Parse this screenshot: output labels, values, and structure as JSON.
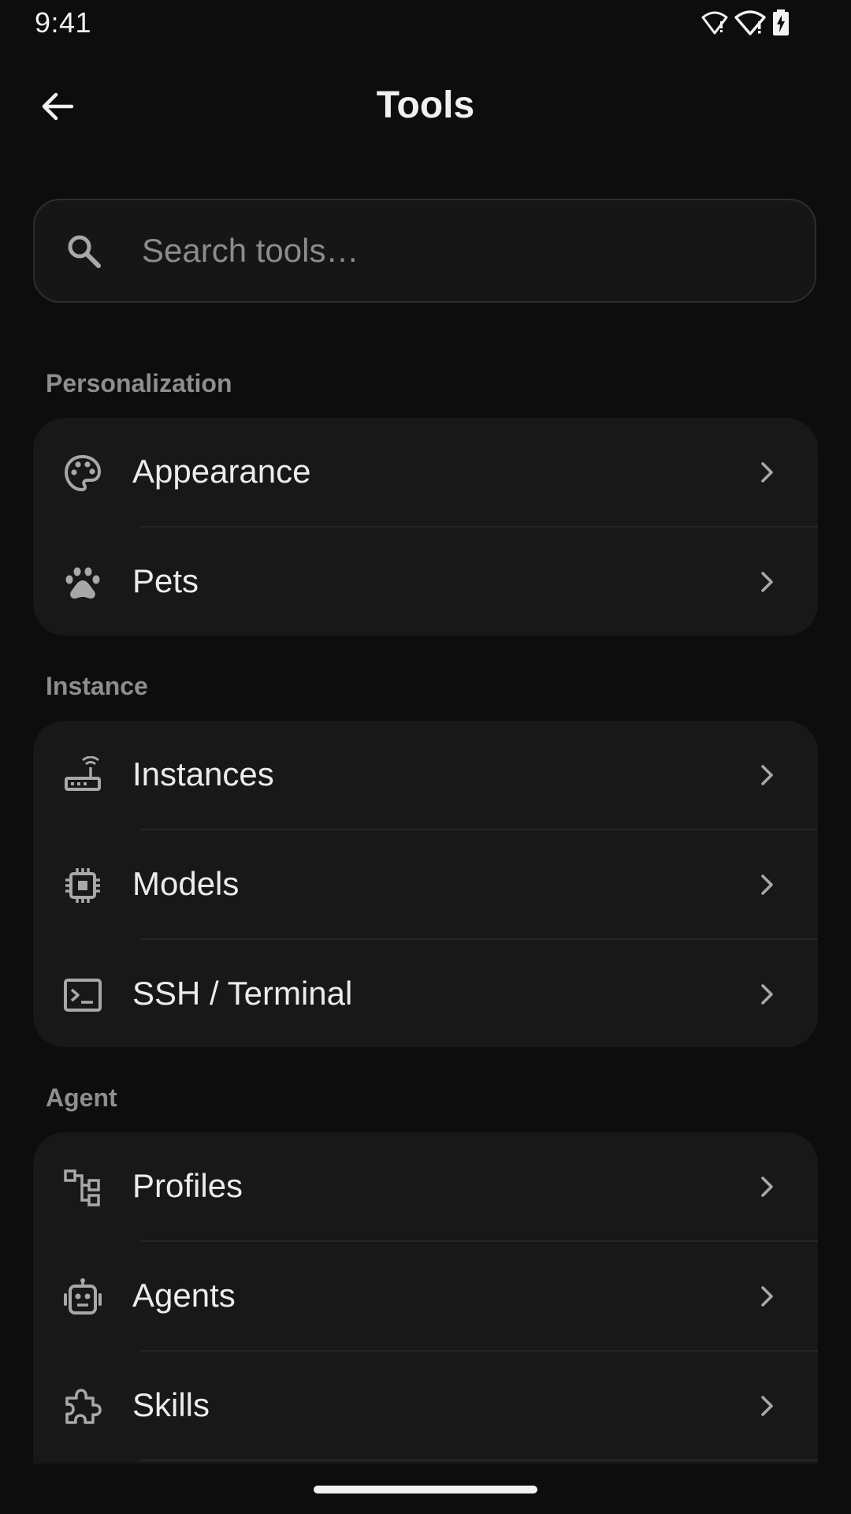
{
  "status_bar": {
    "time": "9:41",
    "icons": [
      "wifi-alert-icon",
      "wifi-alert-icon",
      "battery-charging-icon"
    ]
  },
  "app_bar": {
    "title": "Tools",
    "back_icon": "arrow-back-icon"
  },
  "search": {
    "placeholder": "Search tools…",
    "value": "",
    "icon": "search-icon"
  },
  "sections": [
    {
      "title": "Personalization",
      "items": [
        {
          "label": "Appearance",
          "icon": "palette-icon"
        },
        {
          "label": "Pets",
          "icon": "paw-icon"
        }
      ]
    },
    {
      "title": "Instance",
      "items": [
        {
          "label": "Instances",
          "icon": "router-icon"
        },
        {
          "label": "Models",
          "icon": "chip-icon"
        },
        {
          "label": "SSH / Terminal",
          "icon": "terminal-icon"
        }
      ]
    },
    {
      "title": "Agent",
      "items": [
        {
          "label": "Profiles",
          "icon": "account-tree-icon"
        },
        {
          "label": "Agents",
          "icon": "robot-icon"
        },
        {
          "label": "Skills",
          "icon": "puzzle-icon"
        }
      ]
    }
  ],
  "colors": {
    "background": "#0d0d0d",
    "card": "#181818",
    "text": "#ececec",
    "muted": "#8e8e8e",
    "icon": "#a8a8a8"
  }
}
